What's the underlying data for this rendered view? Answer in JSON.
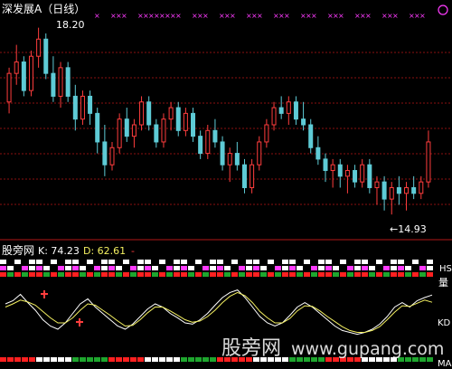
{
  "header": {
    "title": "深发展A（日线）"
  },
  "price_panel": {
    "high_label": "18.20",
    "low_label": "←14.93"
  },
  "indicator_panel": {
    "name": "股旁网",
    "k_text": "K: 74.23",
    "d_text": "D: 62.61",
    "right_labels": [
      "HS",
      "量",
      "KD",
      "MA"
    ]
  },
  "watermark": {
    "brand": "股旁网",
    "url": "www.gupang.com"
  },
  "colors": {
    "up": "#ff3d3d",
    "down": "#5ecbd6",
    "k_line": "#ffffff",
    "d_line": "#f4f061",
    "marker_pink": "#ff3bff",
    "marker_green": "#1ea62e",
    "grid": "#8a1010"
  },
  "chart_data": [
    {
      "type": "bar",
      "title": "深发展A（日线）",
      "annotations": [
        "18.20",
        "14.93"
      ],
      "price_range": [
        14.6,
        18.4
      ],
      "candles": [
        [
          16.9,
          17.5,
          16.7,
          17.4
        ],
        [
          17.4,
          17.9,
          17.2,
          17.6
        ],
        [
          17.6,
          17.7,
          17.0,
          17.1
        ],
        [
          17.1,
          17.8,
          17.0,
          17.7
        ],
        [
          17.7,
          18.2,
          17.5,
          18.0
        ],
        [
          18.0,
          18.1,
          17.3,
          17.4
        ],
        [
          17.4,
          17.7,
          16.9,
          17.0
        ],
        [
          17.0,
          17.6,
          16.8,
          17.5
        ],
        [
          17.5,
          17.6,
          16.9,
          17.0
        ],
        [
          17.0,
          17.2,
          16.4,
          16.6
        ],
        [
          16.6,
          17.1,
          16.5,
          17.0
        ],
        [
          17.0,
          17.1,
          16.5,
          16.7
        ],
        [
          16.7,
          16.8,
          16.0,
          16.2
        ],
        [
          16.2,
          16.5,
          15.6,
          15.8
        ],
        [
          15.8,
          16.2,
          15.7,
          16.1
        ],
        [
          16.1,
          16.7,
          16.0,
          16.6
        ],
        [
          16.6,
          16.8,
          16.2,
          16.3
        ],
        [
          16.3,
          16.6,
          16.1,
          16.5
        ],
        [
          16.5,
          17.0,
          16.4,
          16.9
        ],
        [
          16.9,
          17.0,
          16.4,
          16.5
        ],
        [
          16.5,
          16.6,
          16.1,
          16.2
        ],
        [
          16.2,
          16.7,
          16.1,
          16.6
        ],
        [
          16.6,
          16.9,
          16.4,
          16.8
        ],
        [
          16.8,
          16.9,
          16.3,
          16.4
        ],
        [
          16.4,
          16.8,
          16.3,
          16.7
        ],
        [
          16.7,
          16.8,
          16.2,
          16.3
        ],
        [
          16.3,
          16.4,
          15.9,
          16.0
        ],
        [
          16.0,
          16.5,
          15.9,
          16.4
        ],
        [
          16.4,
          16.6,
          16.1,
          16.2
        ],
        [
          16.2,
          16.3,
          15.7,
          15.8
        ],
        [
          15.8,
          16.1,
          15.5,
          16.0
        ],
        [
          16.0,
          16.2,
          15.7,
          15.8
        ],
        [
          15.8,
          15.9,
          15.3,
          15.4
        ],
        [
          15.4,
          15.9,
          15.3,
          15.8
        ],
        [
          15.8,
          16.3,
          15.7,
          16.2
        ],
        [
          16.2,
          16.6,
          16.1,
          16.5
        ],
        [
          16.5,
          16.9,
          16.4,
          16.8
        ],
        [
          16.8,
          17.0,
          16.6,
          16.7
        ],
        [
          16.7,
          17.0,
          16.5,
          16.9
        ],
        [
          16.9,
          17.0,
          16.5,
          16.6
        ],
        [
          16.6,
          16.9,
          16.4,
          16.5
        ],
        [
          16.5,
          16.6,
          16.0,
          16.1
        ],
        [
          16.1,
          16.3,
          15.8,
          15.9
        ],
        [
          15.9,
          16.0,
          15.5,
          15.7
        ],
        [
          15.7,
          15.9,
          15.4,
          15.8
        ],
        [
          15.8,
          15.9,
          15.4,
          15.6
        ],
        [
          15.6,
          15.8,
          15.3,
          15.7
        ],
        [
          15.7,
          15.8,
          15.4,
          15.5
        ],
        [
          15.5,
          15.9,
          15.4,
          15.8
        ],
        [
          15.8,
          15.9,
          15.3,
          15.4
        ],
        [
          15.4,
          15.6,
          15.1,
          15.5
        ],
        [
          15.5,
          15.6,
          15.0,
          15.2
        ],
        [
          15.2,
          15.5,
          14.93,
          15.4
        ],
        [
          15.4,
          15.6,
          15.1,
          15.3
        ],
        [
          15.3,
          15.5,
          15.0,
          15.4
        ],
        [
          15.4,
          15.6,
          15.2,
          15.3
        ],
        [
          15.3,
          15.6,
          15.2,
          15.5
        ],
        [
          15.5,
          16.4,
          15.4,
          16.2
        ]
      ]
    },
    {
      "type": "line",
      "title": "股旁网",
      "ylim": [
        0,
        100
      ],
      "series": [
        {
          "name": "K",
          "values": [
            60,
            65,
            75,
            62,
            50,
            35,
            25,
            20,
            30,
            45,
            60,
            68,
            55,
            45,
            35,
            25,
            20,
            28,
            40,
            52,
            60,
            55,
            45,
            38,
            30,
            28,
            35,
            45,
            58,
            70,
            78,
            82,
            70,
            55,
            40,
            30,
            25,
            30,
            42,
            55,
            62,
            55,
            45,
            35,
            25,
            18,
            15,
            12,
            15,
            20,
            28,
            40,
            55,
            62,
            55,
            65,
            70,
            74
          ]
        },
        {
          "name": "D",
          "values": [
            55,
            60,
            66,
            63,
            58,
            48,
            38,
            30,
            30,
            38,
            50,
            60,
            58,
            50,
            42,
            33,
            25,
            26,
            35,
            46,
            55,
            55,
            49,
            42,
            35,
            31,
            33,
            40,
            50,
            62,
            72,
            78,
            73,
            62,
            48,
            38,
            30,
            30,
            37,
            49,
            57,
            56,
            49,
            40,
            32,
            24,
            18,
            15,
            15,
            18,
            24,
            35,
            47,
            57,
            56,
            61,
            66,
            62.61
          ]
        }
      ]
    }
  ]
}
